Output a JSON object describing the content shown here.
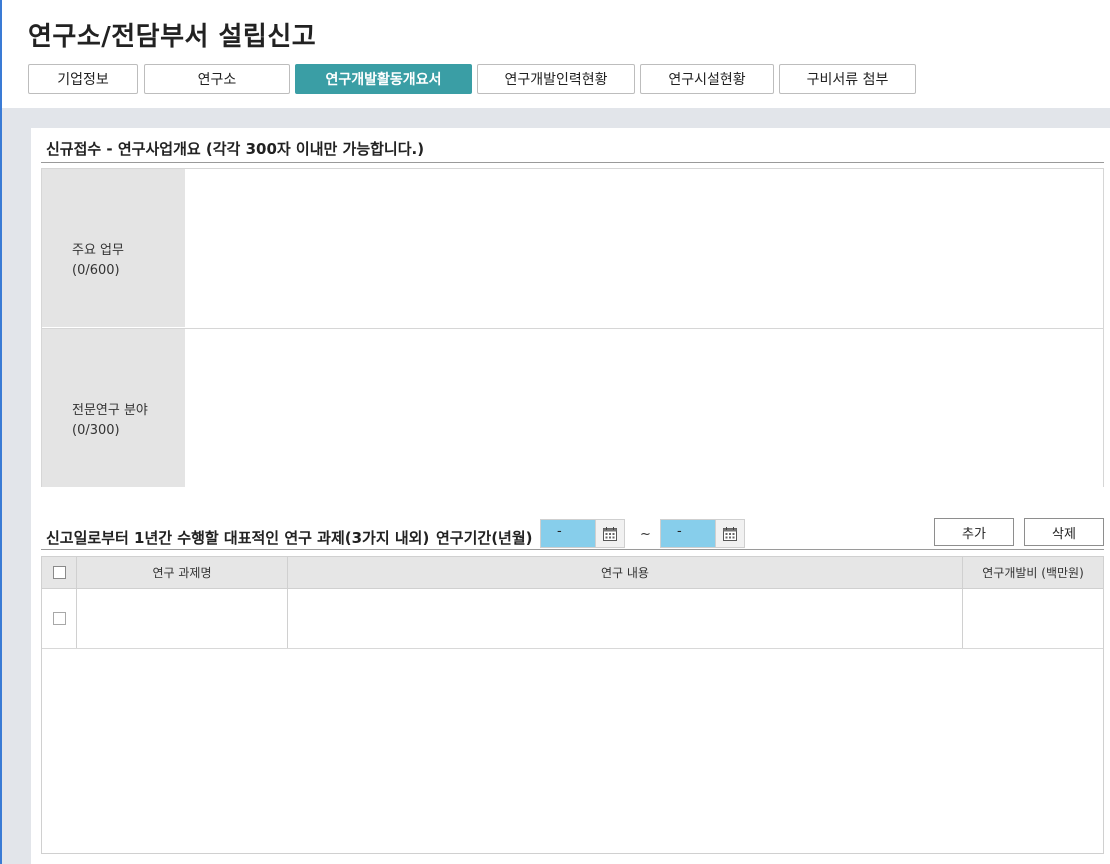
{
  "page": {
    "title": "연구소/전담부서 설립신고"
  },
  "tabs": [
    {
      "label": "기업정보",
      "active": false
    },
    {
      "label": "연구소",
      "active": false
    },
    {
      "label": "연구개발활동개요서",
      "active": true
    },
    {
      "label": "연구개발인력현황",
      "active": false
    },
    {
      "label": "연구시설현황",
      "active": false
    },
    {
      "label": "구비서류 첨부",
      "active": false
    }
  ],
  "overview": {
    "title": "신규접수 - 연구사업개요 (각각 300자 이내만 가능합니다.)",
    "rows": [
      {
        "label": "주요 업무",
        "count": "(0/600)",
        "value": ""
      },
      {
        "label": "전문연구 분야",
        "count": "(0/300)",
        "value": ""
      }
    ]
  },
  "projects": {
    "title": "신고일로부터 1년간 수행할 대표적인 연구 과제(3가지 내외)",
    "period_label": "연구기간(년월)",
    "date_from": "-",
    "date_to": "-",
    "tilde": "~",
    "add_label": "추가",
    "delete_label": "삭제",
    "columns": [
      "연구 과제명",
      "연구 내용",
      "연구개발비 (백만원)"
    ],
    "rows": [
      {
        "name": "",
        "content": "",
        "cost": ""
      }
    ]
  },
  "icons": {
    "calendar": "calendar-icon"
  },
  "colors": {
    "active_tab": "#3a9ea5",
    "date_field": "#87ceeb",
    "background_band": "#e2e5ea"
  }
}
